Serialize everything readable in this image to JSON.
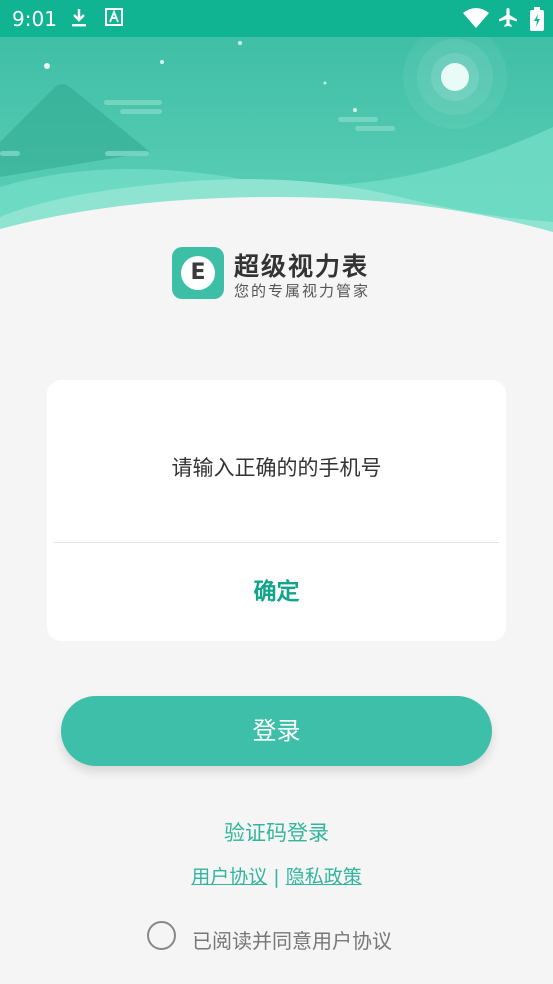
{
  "status_bar": {
    "time": "9:01",
    "icons": [
      "download-icon",
      "font-a-icon",
      "wifi-icon",
      "airplane-icon",
      "battery-icon"
    ]
  },
  "brand": {
    "logo_letter": "E",
    "title": "超级视力表",
    "subtitle": "您的专属视力管家"
  },
  "dialog": {
    "message": "请输入正确的的手机号",
    "confirm_label": "确定"
  },
  "login": {
    "button_label": "登录",
    "sms_login_link": "验证码登录",
    "user_agreement_link": "用户协议",
    "separator": "|",
    "privacy_policy_link": "隐私政策",
    "consent_text": "已阅读并同意用户协议"
  },
  "colors": {
    "accent": "#3dbfa9",
    "status_bar": "#10b493",
    "link": "#33b59d"
  }
}
